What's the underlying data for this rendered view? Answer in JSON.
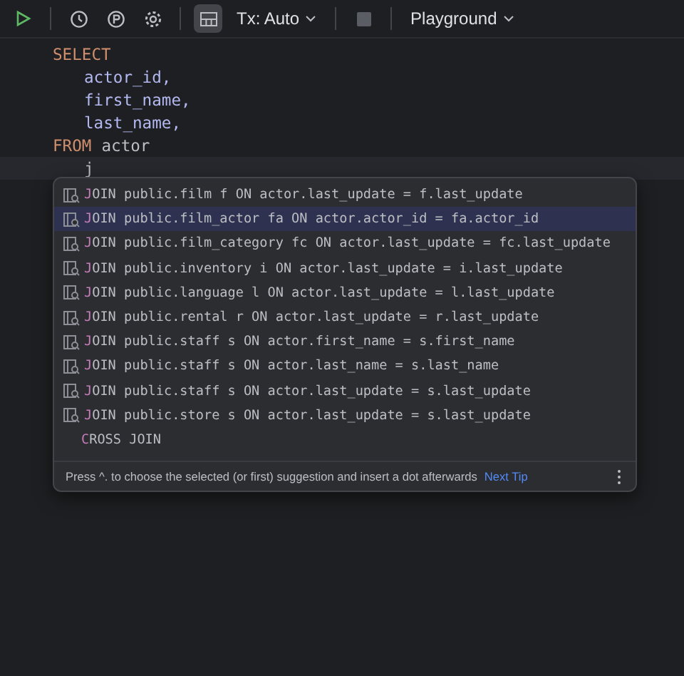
{
  "toolbar": {
    "tx_mode": "Tx: Auto",
    "session": "Playground",
    "grid_selected": true
  },
  "editor": {
    "lines": [
      {
        "tokens": [
          {
            "kind": "keyword",
            "text": "SELECT"
          }
        ],
        "indent": false,
        "current": false
      },
      {
        "tokens": [
          {
            "kind": "column",
            "text": "actor_id,"
          }
        ],
        "indent": true,
        "current": false
      },
      {
        "tokens": [
          {
            "kind": "column",
            "text": "first_name,"
          }
        ],
        "indent": true,
        "current": false
      },
      {
        "tokens": [
          {
            "kind": "column",
            "text": "last_name,"
          }
        ],
        "indent": true,
        "current": false
      },
      {
        "tokens": [
          {
            "kind": "keyword",
            "text": "FROM"
          },
          {
            "kind": "name",
            "text": "actor"
          }
        ],
        "indent": false,
        "current": false
      },
      {
        "tokens": [
          {
            "kind": "name",
            "text": "j"
          }
        ],
        "indent": true,
        "current": true
      }
    ]
  },
  "completion": {
    "items": [
      {
        "kind": "join",
        "text": "JOIN public.film f ON actor.last_update = f.last_update",
        "selected": false
      },
      {
        "kind": "join",
        "text": "JOIN public.film_actor fa ON actor.actor_id = fa.actor_id",
        "selected": true
      },
      {
        "kind": "join",
        "text": "JOIN public.film_category fc ON actor.last_update = fc.last_update",
        "selected": false
      },
      {
        "kind": "join",
        "text": "JOIN public.inventory i ON actor.last_update = i.last_update",
        "selected": false
      },
      {
        "kind": "join",
        "text": "JOIN public.language l ON actor.last_update = l.last_update",
        "selected": false
      },
      {
        "kind": "join",
        "text": "JOIN public.rental r ON actor.last_update = r.last_update",
        "selected": false
      },
      {
        "kind": "join",
        "text": "JOIN public.staff s ON actor.first_name = s.first_name",
        "selected": false
      },
      {
        "kind": "join",
        "text": "JOIN public.staff s ON actor.last_name = s.last_name",
        "selected": false
      },
      {
        "kind": "join",
        "text": "JOIN public.staff s ON actor.last_update = s.last_update",
        "selected": false
      },
      {
        "kind": "join",
        "text": "JOIN public.store s ON actor.last_update = s.last_update",
        "selected": false
      },
      {
        "kind": "keyword",
        "text": "CROSS JOIN",
        "selected": false
      }
    ],
    "hint": "Press ^. to choose the selected (or first) suggestion and insert a dot afterwards",
    "hint_link": "Next Tip"
  }
}
